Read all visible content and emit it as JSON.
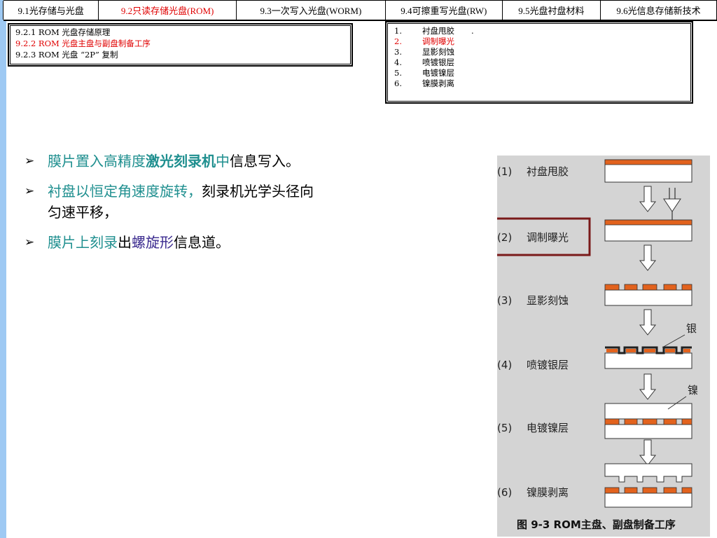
{
  "tabs": [
    {
      "label": "9.1光存储与光盘",
      "active": false
    },
    {
      "label": "9.2只读存储光盘(ROM)",
      "active": true
    },
    {
      "label": "9.3一次写入光盘(WORM)",
      "active": false
    },
    {
      "label": "9.4可擦重写光盘(RW)",
      "active": false
    },
    {
      "label": "9.5光盘衬盘材料",
      "active": false
    },
    {
      "label": "9.6光信息存储新技术",
      "active": false
    }
  ],
  "subsections": [
    {
      "label": "9.2.1 ROM 光盘存储原理",
      "active": false
    },
    {
      "label": "9.2.2 ROM 光盘主盘与副盘制备工序",
      "active": true
    },
    {
      "label": "9.2.3 ROM 光盘 “2P” 复制",
      "active": false
    }
  ],
  "steps": [
    {
      "num": "1.",
      "label": "衬盘甩胶",
      "note": ".",
      "active": false
    },
    {
      "num": "2.",
      "label": "调制曝光",
      "note": "",
      "active": true
    },
    {
      "num": "3.",
      "label": "显影刻蚀",
      "note": "",
      "active": false
    },
    {
      "num": "4.",
      "label": "喷镀银层",
      "note": "",
      "active": false
    },
    {
      "num": "5.",
      "label": "电镀镍层",
      "note": "",
      "active": false
    },
    {
      "num": "6.",
      "label": "镍膜剥离",
      "note": "",
      "active": false
    }
  ],
  "bullets": {
    "b1": {
      "p1": "膜片置入高精度",
      "p2": "激光刻录机",
      "p3": "中",
      "p4": "信息写入。"
    },
    "b2": {
      "p1": "衬盘以恒定角速度旋转，",
      "p2": "刻录机光学头径向",
      "p3": "匀速平移，"
    },
    "b3": {
      "p1": "膜片上刻录",
      "p2": "出",
      "p3": "螺旋形",
      "p4": "信息道。"
    }
  },
  "figure": {
    "steps": [
      {
        "num": "(1)",
        "label": "衬盘甩胶"
      },
      {
        "num": "(2)",
        "label": "调制曝光"
      },
      {
        "num": "(3)",
        "label": "显影刻蚀"
      },
      {
        "num": "(4)",
        "label": "喷镀银层"
      },
      {
        "num": "(5)",
        "label": "电镀镍层"
      },
      {
        "num": "(6)",
        "label": "镍膜剥离"
      }
    ],
    "callout_silver": "银",
    "callout_nickel": "镍",
    "caption": "图 9-3 ROM主盘、副盘制备工序"
  },
  "colors": {
    "active_red": "#e00000",
    "teal": "#1f8f8f",
    "purple": "#3b2b8f",
    "resist_orange": "#e2621d",
    "highlight_frame": "#7a1a1a",
    "figure_bg": "#d4d4d4",
    "left_bar": "#9ec9f3"
  }
}
